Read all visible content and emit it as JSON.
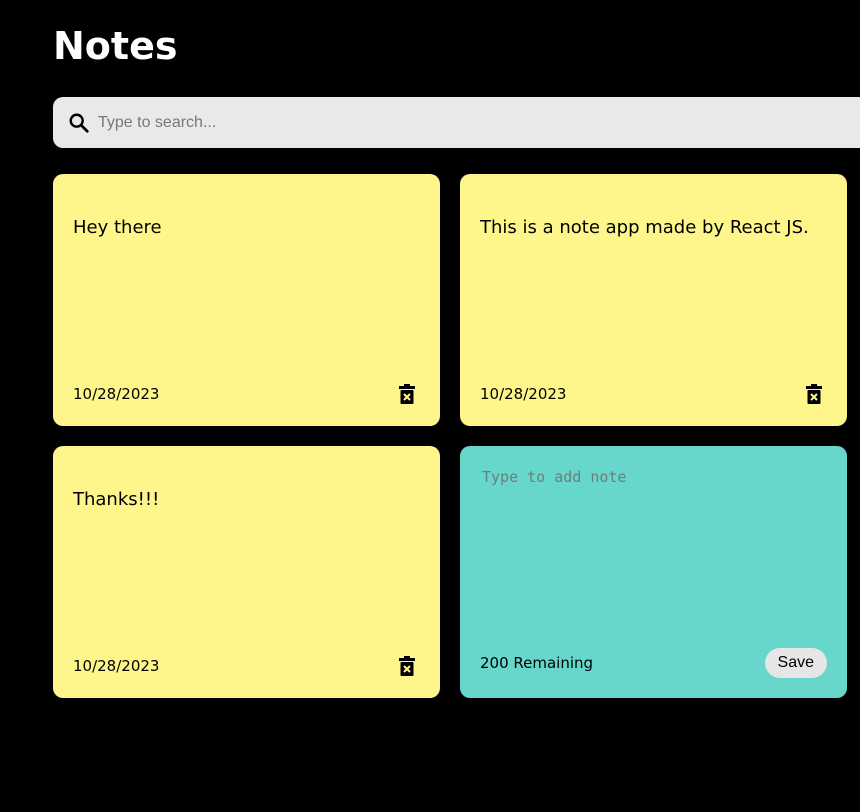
{
  "header": {
    "title": "Notes"
  },
  "search": {
    "placeholder": "Type to search...",
    "icon": "search-icon"
  },
  "notes": [
    {
      "text": "Hey there",
      "date": "10/28/2023"
    },
    {
      "text": "This is a note app made by React JS.",
      "date": "10/28/2023"
    },
    {
      "text": "Thanks!!!",
      "date": "10/28/2023"
    }
  ],
  "add_note": {
    "placeholder": "Type to add note",
    "remaining": "200 Remaining",
    "save_label": "Save"
  },
  "colors": {
    "note": "#fef68a",
    "new_note": "#67d7cc",
    "background": "#000000"
  }
}
